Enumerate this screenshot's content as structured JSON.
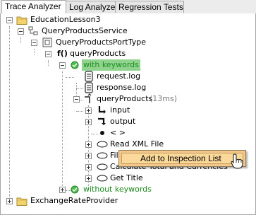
{
  "tabs": [
    "Trace Analyzer",
    "Log Analyzer",
    "Regression Tests"
  ],
  "tree": {
    "project": "EducationLesson3",
    "service": "QueryProductsService",
    "port_type": "QueryProductsPortType",
    "operation": "queryProducts",
    "with_keywords": "with keywords",
    "request_log": "request.log",
    "response_log": "response.log",
    "call": "queryProducts",
    "call_duration": "(13ms)",
    "input": "input",
    "output": "output",
    "element": "< >",
    "read_xml": "Read XML File",
    "filter_partial": "Fil",
    "calculate": "Calculate Total and Currencies",
    "get_title": "Get Title",
    "without_keywords": "without keywords",
    "exchange": "ExchangeRateProvider"
  },
  "context_menu": {
    "item": "Add to Inspection List"
  }
}
